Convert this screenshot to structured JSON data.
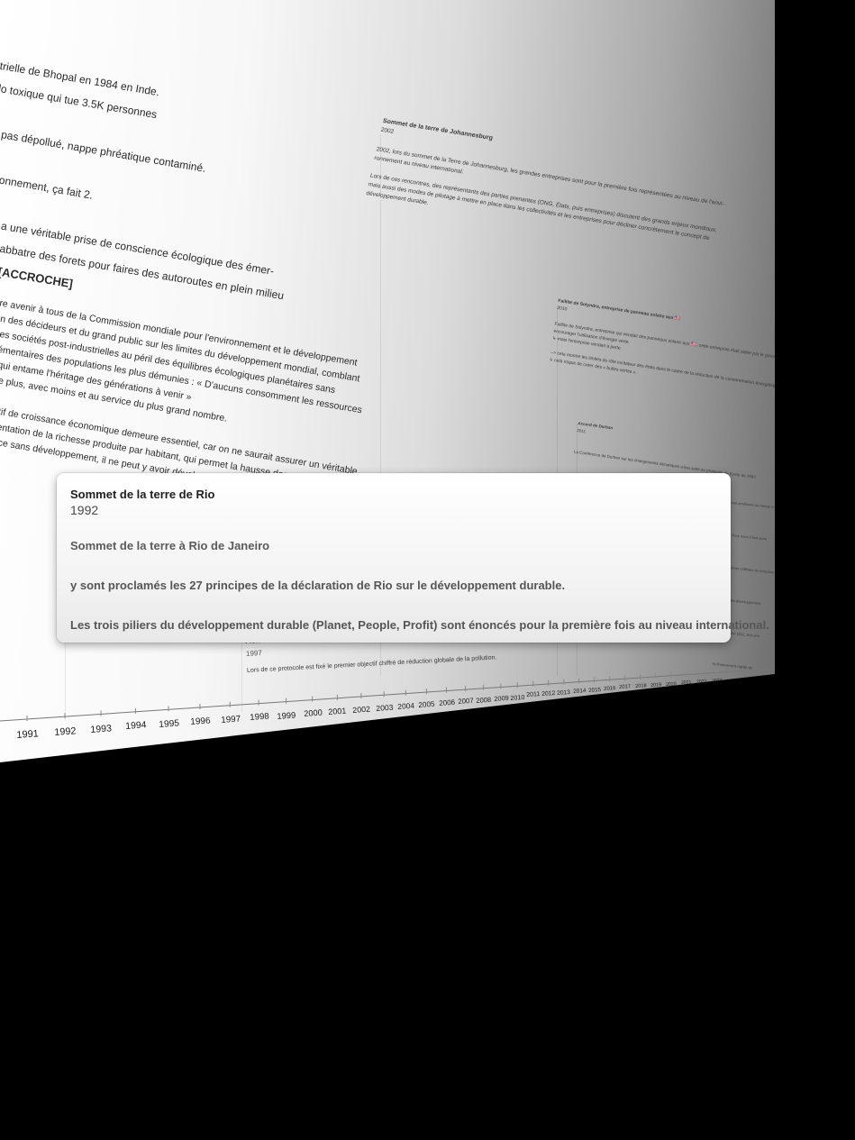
{
  "background": {
    "para1_lines": [
      "strielle de Bhopal en 1984 en Inde.",
      "silo toxique qui tue 3.5K personnes",
      "",
      "urs pas dépollué, nappe phréatique contaminé.",
      "",
      "environnement, ça fait 2.",
      "",
      "92, on a une véritable prise de conscience écologique des émer-",
      "t pas à abbatre des forets pour faires des autoroutes en plein milieu"
    ],
    "para1_heading": "CMED [ACCROCHE]",
    "para2_lines": [
      "apport Notre avenir à tous de la Commission mondiale pour l'environnement et le développement",
      "ait l'attention des décideurs et du grand public sur les limites du développement mondial, comblant",
      "émesurés des sociétés post-industrielles au péril des équilibres écologiques planétaires sans",
      "x besoins élémentaires des populations les plus démunies : « D'aucuns consomment les ressources",
      "à un rythme qui entame l'héritage des générations à venir »",
      "fet de produire plus, avec moins et au service du plus grand nombre.",
      "",
      "s : c'est l'objectif de croissance économique demeure essentiel, car on ne saurait assurer un véritable",
      "ent sans augmentation de la richesse produite par habitant, qui permet la hausse des niveaux de",
      "y avoir croissance sans développement, il ne peut y avoir développement sans croissance."
    ],
    "joburg": {
      "title": "Sommet de la terre de Johannesburg",
      "year": "2002",
      "lines": [
        "2002, lors du sommet de la Terre de Johannesburg, les grandes entreprises sont pour la première fois représentées au niveau de l'envi-",
        "ronnement au niveau international.",
        "",
        "Lors de ces rencontres, des représentants des parties prenantes (ONG, États, puis entreprises) discutent des grands enjeux mondiaux,",
        "mais aussi des modes de pilotage à mettre en place dans les collectivités et les entreprises pour décliner concrètement le concept de",
        "développement durable."
      ]
    },
    "solyndra": {
      "title": "Faillite de Solyndra, entreprise de panneau solaire aux 🇺🇸",
      "year": "2010",
      "lines": [
        "Faillite de Solyndra, entreprise qui vendait des panneaux solaire aux 🇺🇸, cette entreprise était aidée par le gouvernement, pour",
        "encourager l'utilisation d'énergie verte.",
        "   ↳ mais l'entreprise vendait à perte.",
        "",
        "--> cela montre les limites du rôle incitateur des états dans le cadre de la réduction de la consommation énergétique",
        "   ↳ cela risque de créer des « bulles vertes »."
      ]
    },
    "durban": {
      "title": "Accord de Durban",
      "year": "2011",
      "lines": [
        "",
        "La Conférence de Durban sur les changements climatiques a lieu suite au protocole de Kyoto de 1997."
      ]
    },
    "kyoto": {
      "title": "Protocole de Kyoto",
      "year": "1997",
      "text": "Lors de ce protocole est fixé le premier objectif chiffré de réduction globale de la pollution."
    },
    "right_col": [
      "s'est améliorée au niveau m",
      "--> Pour nous il faut avan",
      "premières chiffrées de réduction",
      "avenir les développement",
      "le 31 janvier 2012, leur prio",
      "le financement rapide de"
    ]
  },
  "timeline": {
    "years": [
      "1991",
      "1992",
      "1993",
      "1994",
      "1995",
      "1996",
      "1997",
      "1998",
      "1999",
      "2000",
      "2001",
      "2002",
      "2003",
      "2004",
      "2005",
      "2006",
      "2007",
      "2008",
      "2009",
      "2010",
      "2011",
      "2012",
      "2013",
      "2014",
      "2015",
      "2016",
      "2017",
      "2018",
      "2019",
      "2020",
      "2021",
      "2022",
      "2023"
    ]
  },
  "popup": {
    "title": "Sommet de la terre de Rio",
    "year": "1992",
    "line1": "Sommet de la terre à Rio de Janeiro",
    "line2": "y sont proclamés les 27 principes de la déclaration de Rio sur le développement durable.",
    "line3": "Les trois piliers du développement durable (Planet, People, Profit) sont énoncés pour la première fois au niveau international."
  }
}
